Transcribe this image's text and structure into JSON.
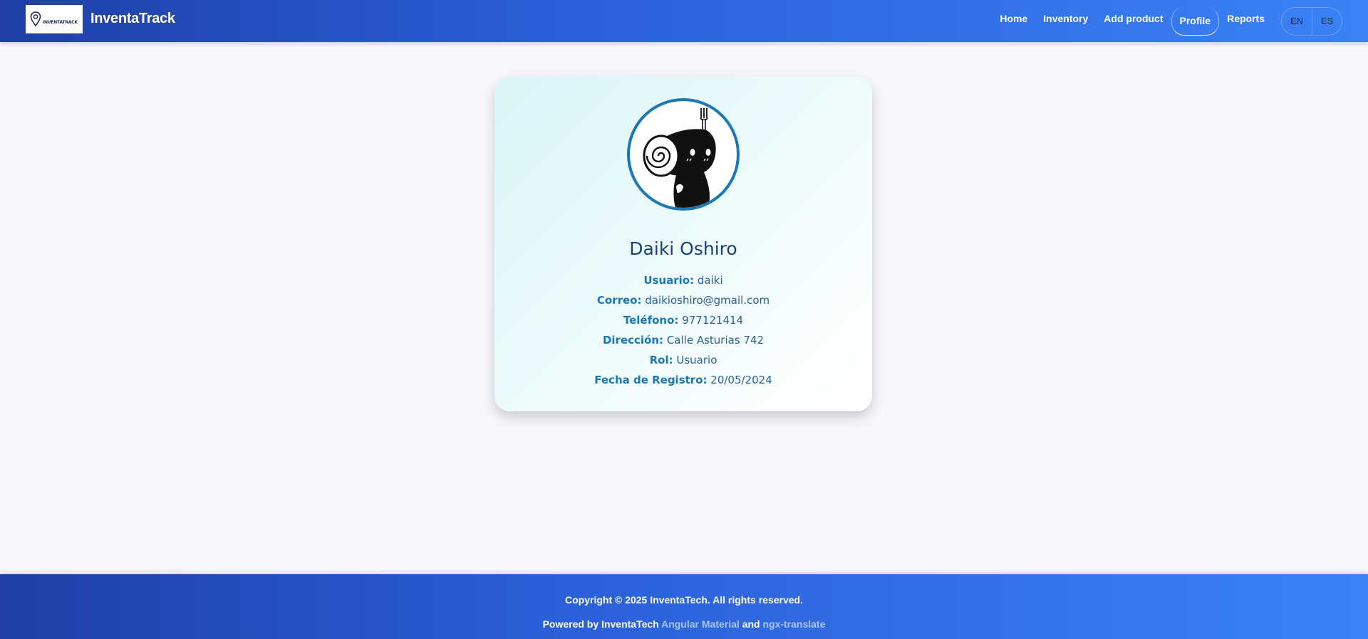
{
  "header": {
    "logo_text": "INVENTATRACK",
    "brand": "InventaTrack",
    "nav": [
      {
        "label": "Home",
        "active": false
      },
      {
        "label": "Inventory",
        "active": false
      },
      {
        "label": "Add product",
        "active": false
      },
      {
        "label": "Profile",
        "active": true
      },
      {
        "label": "Reports",
        "active": false
      }
    ],
    "languages": [
      "EN",
      "ES"
    ]
  },
  "profile": {
    "name": "Daiki Oshiro",
    "fields": [
      {
        "label": "Usuario:",
        "value": "daiki"
      },
      {
        "label": "Correo:",
        "value": "daikioshiro@gmail.com"
      },
      {
        "label": "Teléfono:",
        "value": "977121414"
      },
      {
        "label": "Dirección:",
        "value": "Calle Asturias 742"
      },
      {
        "label": "Rol:",
        "value": "Usuario"
      },
      {
        "label": "Fecha de Registro:",
        "value": "20/05/2024"
      }
    ]
  },
  "footer": {
    "copyright": "Copyright © 2025 InventaTech. All rights reserved.",
    "powered_prefix": "Powered by InventaTech",
    "link1": "Angular Material",
    "and": "and",
    "link2": "ngx-translate"
  },
  "colors": {
    "header_gradient_start": "#1f3fa6",
    "header_gradient_end": "#3b82f6",
    "accent": "#1b77b6",
    "name_color": "#1d3f7a"
  }
}
